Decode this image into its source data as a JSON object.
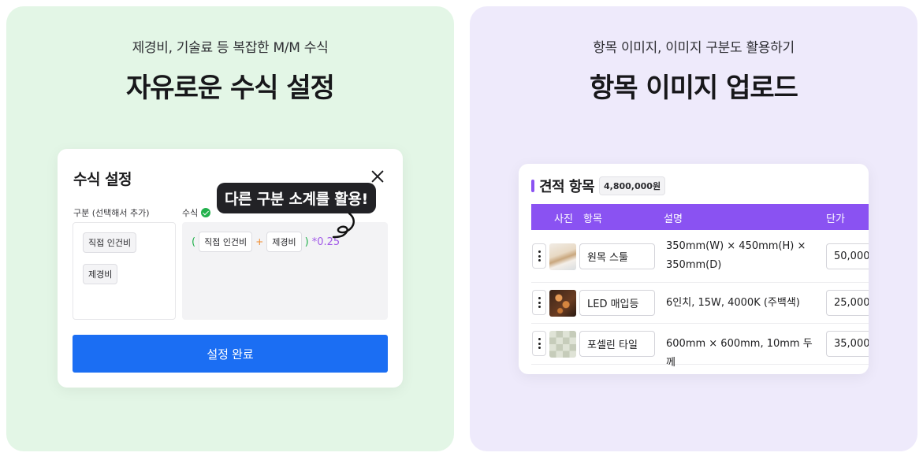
{
  "left_panel": {
    "subtitle": "제경비, 기술료 등 복잡한 M/M 수식",
    "headline": "자유로운 수식 설정",
    "dialog": {
      "title": "수식 설정",
      "category_label": "구분 (선택해서 추가)",
      "formula_label": "수식",
      "category_chips": [
        "직접 인건비",
        "제경비"
      ],
      "formula": {
        "open_paren": "(",
        "term1": "직접 인건비",
        "operator": "+",
        "term2": "제경비",
        "close_paren": ")",
        "multiplier": "*0.25"
      },
      "callout": "다른 구분 소계를 활용!",
      "done_button": "설정 완료"
    }
  },
  "right_panel": {
    "subtitle": "항목 이미지, 이미지 구분도 활용하기",
    "headline": "항목 이미지 업로드",
    "card": {
      "title": "견적 항목",
      "total": "4,800,000원",
      "columns": {
        "photo": "사진",
        "item": "항목",
        "description": "설명",
        "unit_price": "단가"
      },
      "rows": [
        {
          "name": "원목 스툴",
          "description": "350mm(W) × 450mm(H) × 350mm(D)",
          "price": "50,000",
          "image": "wooden-stool"
        },
        {
          "name": "LED 매입등",
          "description": "6인치, 15W, 4000K (주백색)",
          "price": "25,000",
          "image": "led-downlight"
        },
        {
          "name": "포셀린 타일",
          "description": "600mm × 600mm, 10mm 두께",
          "price": "35,000",
          "image": "porcelain-tile"
        }
      ]
    }
  },
  "colors": {
    "left_bg": "#e3f6e6",
    "right_bg": "#eeeafb",
    "primary_blue": "#1b6ef3",
    "accent_purple": "#8a52f2",
    "check_green": "#22b14c"
  }
}
